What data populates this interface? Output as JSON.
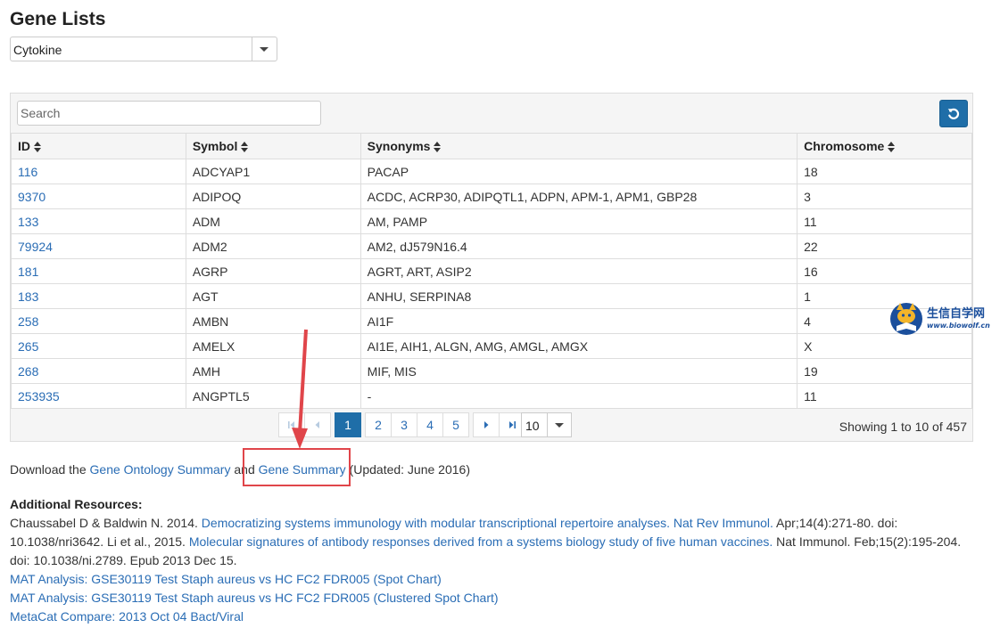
{
  "page": {
    "title": "Gene Lists"
  },
  "gene_list_select": {
    "value": "Cytokine"
  },
  "table": {
    "search_placeholder": "Search",
    "columns": [
      "ID",
      "Symbol",
      "Synonyms",
      "Chromosome"
    ],
    "rows": [
      {
        "id": "116",
        "symbol": "ADCYAP1",
        "synonyms": "PACAP",
        "chromosome": "18"
      },
      {
        "id": "9370",
        "symbol": "ADIPOQ",
        "synonyms": "ACDC, ACRP30, ADIPQTL1, ADPN, APM-1, APM1, GBP28",
        "chromosome": "3"
      },
      {
        "id": "133",
        "symbol": "ADM",
        "synonyms": "AM, PAMP",
        "chromosome": "11"
      },
      {
        "id": "79924",
        "symbol": "ADM2",
        "synonyms": "AM2, dJ579N16.4",
        "chromosome": "22"
      },
      {
        "id": "181",
        "symbol": "AGRP",
        "synonyms": "AGRT, ART, ASIP2",
        "chromosome": "16"
      },
      {
        "id": "183",
        "symbol": "AGT",
        "synonyms": "ANHU, SERPINA8",
        "chromosome": "1"
      },
      {
        "id": "258",
        "symbol": "AMBN",
        "synonyms": "AI1F",
        "chromosome": "4"
      },
      {
        "id": "265",
        "symbol": "AMELX",
        "synonyms": "AI1E, AIH1, ALGN, AMG, AMGL, AMGX",
        "chromosome": "X"
      },
      {
        "id": "268",
        "symbol": "AMH",
        "synonyms": "MIF, MIS",
        "chromosome": "19"
      },
      {
        "id": "253935",
        "symbol": "ANGPTL5",
        "synonyms": "-",
        "chromosome": "11"
      }
    ]
  },
  "pagination": {
    "pages": [
      "1",
      "2",
      "3",
      "4",
      "5"
    ],
    "active_page": "1",
    "page_size": "10",
    "showing_text": "Showing 1 to 10 of 457"
  },
  "download": {
    "prefix": "Download the ",
    "link1": "Gene Ontology Summary",
    "middle": " and ",
    "link2": "Gene Summary",
    "suffix": " (Updated: June 2016)"
  },
  "resources": {
    "heading": "Additional Resources:",
    "ref1_prefix": "Chaussabel D & Baldwin N. 2014. ",
    "ref1_link": "Democratizing systems immunology with modular transcriptional repertoire analyses. Nat Rev Immunol.",
    "ref1_suffix": " Apr;14(4):271-80. doi: 10.1038/nri3642. Li et al., 2015. ",
    "ref2_link": "Molecular signatures of antibody responses derived from a systems biology study of five human vaccines.",
    "ref2_suffix": " Nat Immunol. Feb;15(2):195-204. doi: 10.1038/ni.2789. Epub 2013 Dec 15.",
    "links": [
      "MAT Analysis: GSE30119 Test Staph aureus vs HC FC2 FDR005 (Spot Chart)",
      "MAT Analysis: GSE30119 Test Staph aureus vs HC FC2 FDR005 (Clustered Spot Chart)",
      "MetaCat Compare: 2013 Oct 04 Bact/Viral"
    ]
  },
  "watermark": {
    "title": "生信自学网",
    "url": "www.biowolf.cn"
  },
  "colors": {
    "link": "#2a6db5",
    "primary": "#1f6ea8",
    "annotation": "#e0454a"
  }
}
